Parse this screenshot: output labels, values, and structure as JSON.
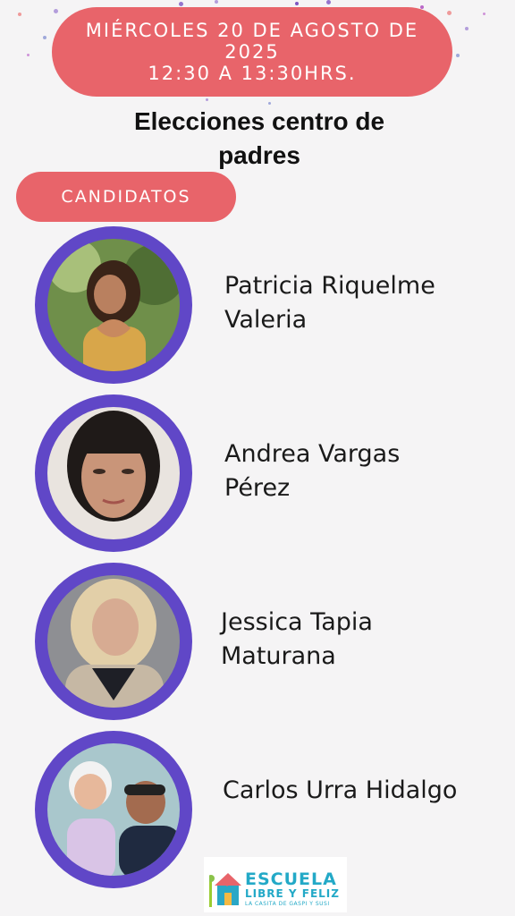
{
  "header": {
    "date_line1": "MIÉRCOLES 20 DE AGOSTO DE",
    "date_line2": "2025",
    "time_line": "12:30 A 13:30HRS."
  },
  "title": {
    "line1": "Elecciones centro de",
    "line2": "padres"
  },
  "section_label": "CANDIDATOS",
  "candidates": [
    {
      "line1": "Patricia Riquelme",
      "line2": "Valeria"
    },
    {
      "line1": "Andrea Vargas",
      "line2": "Pérez"
    },
    {
      "line1": "Jessica Tapia",
      "line2": "Maturana"
    },
    {
      "line1": "Carlos Urra Hidalgo",
      "line2": ""
    }
  ],
  "logo": {
    "line1": "ESCUELA",
    "line2": "LIBRE Y FELIZ",
    "line3": "LA CASITA DE GASPI Y SUSI"
  },
  "colors": {
    "accent": "#e8646a",
    "avatar_ring": "#6047c7",
    "logo_text": "#23a9c7",
    "background": "#f5f4f5"
  }
}
